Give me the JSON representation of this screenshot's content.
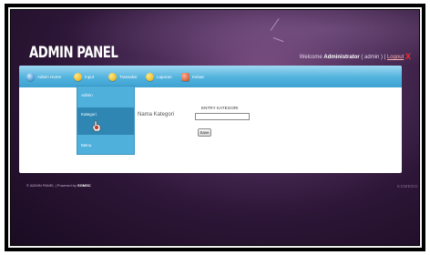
{
  "header": {
    "logo": "ADMIN PANEL",
    "welcome_prefix": "Welcome",
    "user_name": "Administrator",
    "role": "admin",
    "logout_label": "Logout",
    "close_glyph": "X"
  },
  "menu": {
    "items": [
      {
        "label": "Admin Home",
        "icon": "admin-icon"
      },
      {
        "label": "Input",
        "icon": "input-icon"
      },
      {
        "label": "Transaksi",
        "icon": "transaction-icon"
      },
      {
        "label": "Laporan",
        "icon": "report-icon"
      },
      {
        "label": "Keluar",
        "icon": "exit-icon"
      }
    ],
    "dropdown": [
      {
        "label": "Admin"
      },
      {
        "label": "Kategori"
      },
      {
        "label": "Menu"
      }
    ]
  },
  "form": {
    "title": "ENTRY KATEGORI",
    "field_label": "Nama Kategori",
    "field_value": "",
    "save_label": "Save"
  },
  "footer": {
    "text_prefix": "© ADMIN PANEL | Powered by",
    "powered_by": "SGMSC",
    "right_text": "KOMEDO"
  },
  "colors": {
    "menubar": "#51b2dd",
    "dropdown": "#4fb0dc",
    "dropdown_active": "#2f86b3",
    "background": "#2d1637",
    "logout_x": "#ff2a2a"
  }
}
